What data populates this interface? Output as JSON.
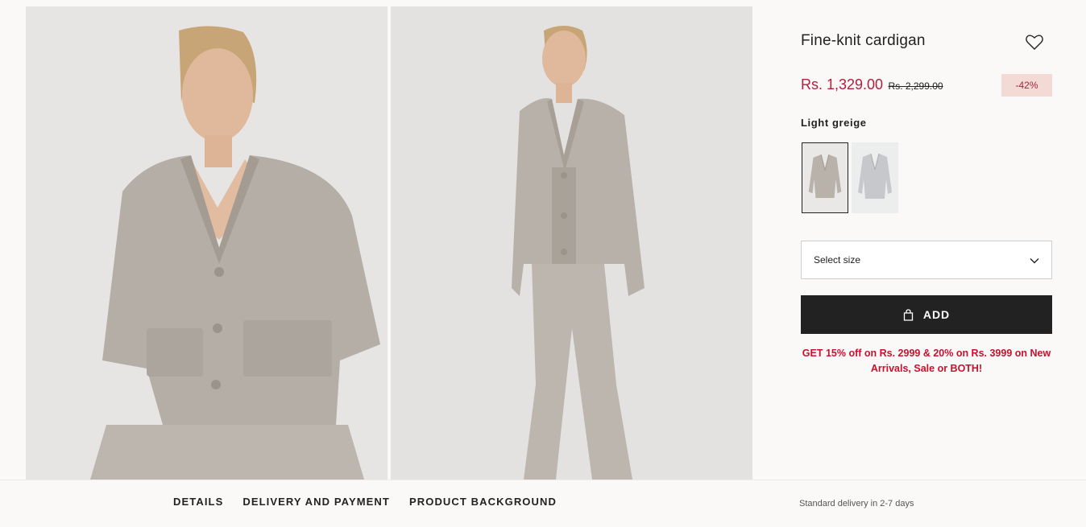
{
  "product": {
    "title": "Fine-knit cardigan",
    "sale_price": "Rs. 1,329.00",
    "original_price": "Rs. 2,299.00",
    "discount": "-42%",
    "color_name": "Light greige",
    "swatches": [
      {
        "icon": "cardigan-greige-thumbnail",
        "selected": true,
        "color": "#b9b2aa"
      },
      {
        "icon": "cardigan-light-grey-thumbnail",
        "selected": false,
        "color": "#c6c8cc"
      }
    ],
    "size_placeholder": "Select size",
    "add_label": "ADD",
    "promo_text": "GET 15% off on Rs. 2999 & 20% on Rs. 3999 on New Arrivals, Sale or BOTH!"
  },
  "tabs": [
    "DETAILS",
    "DELIVERY AND PAYMENT",
    "PRODUCT BACKGROUND"
  ],
  "delivery_note": "Standard delivery in 2-7 days",
  "colors": {
    "sale": "#b0203f",
    "promo": "#c8102e",
    "discount_bg": "#f3dad5",
    "button_bg": "#222222",
    "background": "#faf9f8"
  }
}
